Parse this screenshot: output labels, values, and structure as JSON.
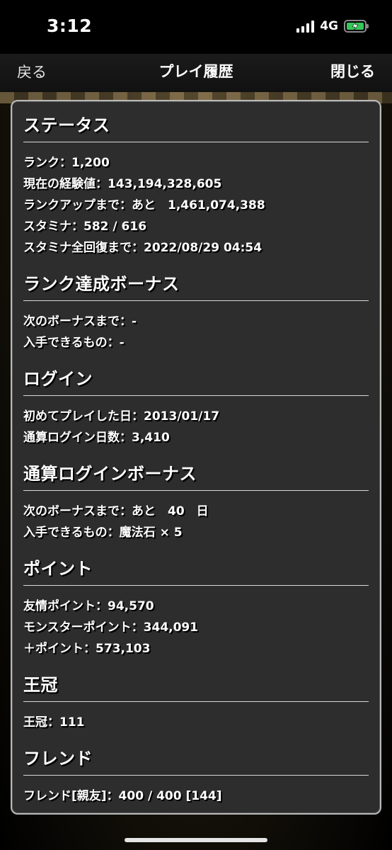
{
  "status_bar": {
    "time": "3:12",
    "network": "4G",
    "battery_color": "#35c759"
  },
  "nav": {
    "back_label": "戻る",
    "title": "プレイ履歴",
    "close_label": "閉じる"
  },
  "sections": [
    {
      "title": "ステータス",
      "rows": [
        "ランク：1,200",
        "現在の経験値：143,194,328,605",
        "ランクアップまで：あと　1,461,074,388",
        "スタミナ：582 / 616",
        "スタミナ全回復まで：2022/08/29 04:54"
      ]
    },
    {
      "title": "ランク達成ボーナス",
      "rows": [
        "次のボーナスまで：-",
        "入手できるもの：-"
      ]
    },
    {
      "title": "ログイン",
      "rows": [
        "初めてプレイした日：2013/01/17",
        "通算ログイン日数：3,410"
      ]
    },
    {
      "title": "通算ログインボーナス",
      "rows": [
        "次のボーナスまで：あと　40　日",
        "入手できるもの：魔法石 × 5"
      ]
    },
    {
      "title": "ポイント",
      "rows": [
        "友情ポイント：94,570",
        "モンスターポイント：344,091",
        "＋ポイント：573,103"
      ]
    },
    {
      "title": "王冠",
      "rows": [
        "王冠：111"
      ]
    },
    {
      "title": "フレンド",
      "rows": [
        "フレンド[親友]：400 / 400 [144]"
      ]
    }
  ]
}
